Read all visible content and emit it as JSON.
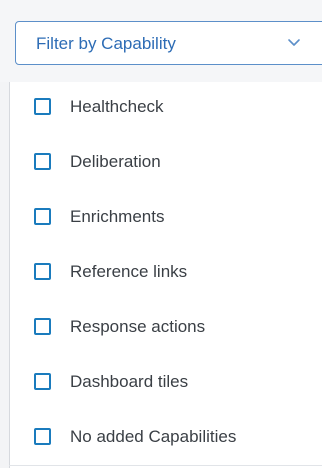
{
  "filter": {
    "label": "Filter by Capability",
    "icon": "chevron-down-icon"
  },
  "options": [
    {
      "label": "Healthcheck",
      "checked": false
    },
    {
      "label": "Deliberation",
      "checked": false
    },
    {
      "label": "Enrichments",
      "checked": false
    },
    {
      "label": "Reference links",
      "checked": false
    },
    {
      "label": "Response actions",
      "checked": false
    },
    {
      "label": "Dashboard tiles",
      "checked": false
    },
    {
      "label": "No added Capabilities",
      "checked": false
    }
  ],
  "colors": {
    "accent": "#2d6cb5",
    "checkbox": "#1a7bbd",
    "text": "#3a3f45"
  }
}
